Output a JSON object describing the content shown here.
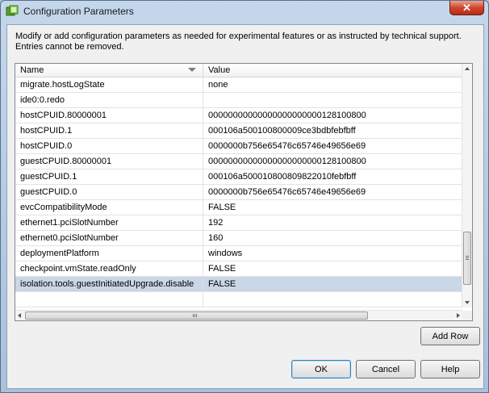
{
  "window": {
    "title": "Configuration Parameters",
    "close_label": "✕"
  },
  "description": "Modify or add configuration parameters as needed for experimental features or as instructed by technical support. Entries cannot be removed.",
  "table": {
    "columns": [
      "Name",
      "Value"
    ],
    "rows": [
      {
        "name": "migrate.hostLogState",
        "value": "none"
      },
      {
        "name": "ide0:0.redo",
        "value": ""
      },
      {
        "name": "hostCPUID.80000001",
        "value": "00000000000000000000000128100800"
      },
      {
        "name": "hostCPUID.1",
        "value": "000106a500100800009ce3bdbfebfbff"
      },
      {
        "name": "hostCPUID.0",
        "value": "0000000b756e65476c65746e49656e69"
      },
      {
        "name": "guestCPUID.80000001",
        "value": "00000000000000000000000128100800"
      },
      {
        "name": "guestCPUID.1",
        "value": "000106a500010800809822010febfbff"
      },
      {
        "name": "guestCPUID.0",
        "value": "0000000b756e65476c65746e49656e69"
      },
      {
        "name": "evcCompatibilityMode",
        "value": "FALSE"
      },
      {
        "name": "ethernet1.pciSlotNumber",
        "value": "192"
      },
      {
        "name": "ethernet0.pciSlotNumber",
        "value": "160"
      },
      {
        "name": "deploymentPlatform",
        "value": "windows"
      },
      {
        "name": "checkpoint.vmState.readOnly",
        "value": "FALSE"
      },
      {
        "name": "isolation.tools.guestInitiatedUpgrade.disable",
        "value": "FALSE"
      },
      {
        "name": "",
        "value": ""
      }
    ],
    "selected_row_index": 13,
    "selected_color": "#cad7e8"
  },
  "buttons": {
    "add_row": "Add Row",
    "ok": "OK",
    "cancel": "Cancel",
    "help": "Help"
  }
}
